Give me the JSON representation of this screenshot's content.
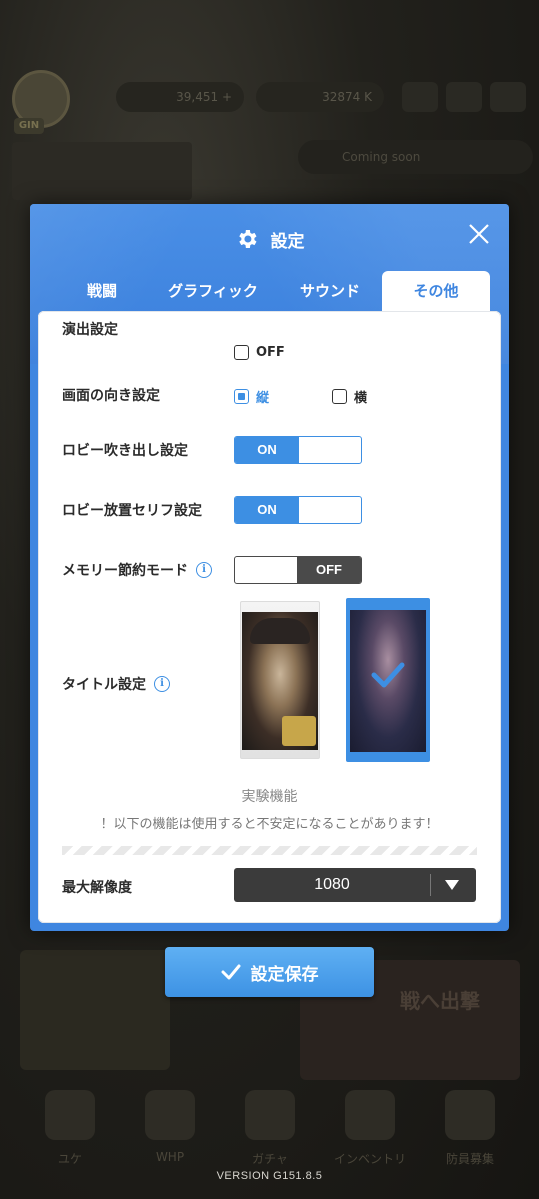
{
  "background": {
    "avatar_tag": "GIN",
    "resource_1": "39,451 +",
    "resource_2": "32874 K",
    "notice_text": "Coming soon",
    "banner_text": "戦へ出撃",
    "nav_items": [
      "ユケ",
      "WHP",
      "ガチャ",
      "インベントリ",
      "防員募集"
    ]
  },
  "modal": {
    "title": "設定",
    "tabs": [
      {
        "label": "戦闘"
      },
      {
        "label": "グラフィック"
      },
      {
        "label": "サウンド"
      },
      {
        "label": "その他",
        "selected": true
      }
    ],
    "settings": {
      "effects": {
        "label": "演出設定",
        "option_label": "OFF",
        "checked": false
      },
      "orientation": {
        "label": "画面の向き設定",
        "portrait_label": "縦",
        "portrait_checked": true,
        "landscape_label": "横",
        "landscape_checked": false
      },
      "lobby_bubble": {
        "label": "ロビー吹き出し設定",
        "state": "ON"
      },
      "lobby_idle": {
        "label": "ロビー放置セリフ設定",
        "state": "ON"
      },
      "memory_save": {
        "label": "メモリー節約モード",
        "state": "OFF"
      },
      "title_setting": {
        "label": "タイトル設定",
        "selected_index": 1
      }
    },
    "experimental": {
      "title": "実験機能",
      "warning": "！以下の機能は使用すると不安定になることがあります！"
    },
    "resolution": {
      "label": "最大解像度",
      "value": "1080"
    },
    "info_glyph": "i"
  },
  "save_button": {
    "label": "設定保存"
  },
  "version": "VERSION  G151.8.5",
  "colors": {
    "accent": "#3d8fe3",
    "header": "#3f86e0",
    "dark": "#3b3b3b"
  }
}
